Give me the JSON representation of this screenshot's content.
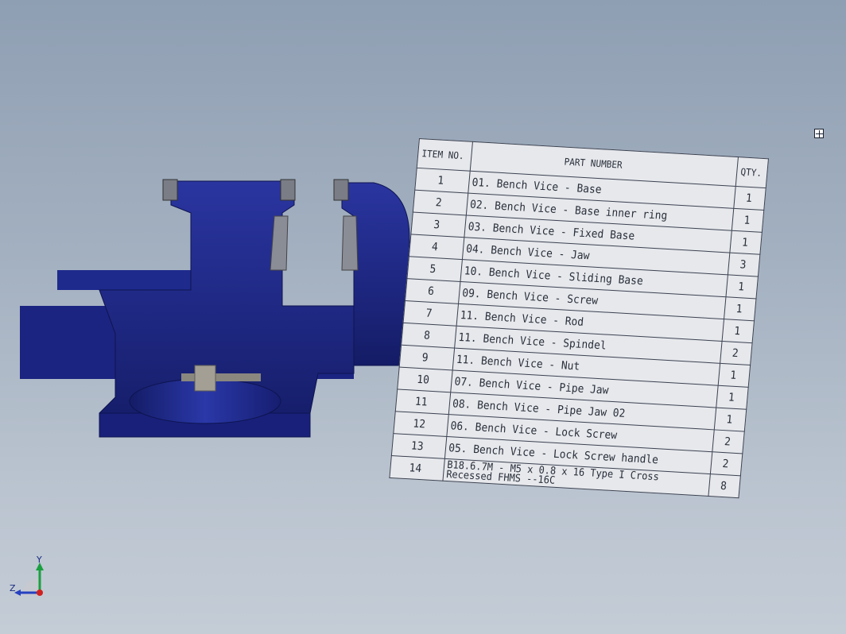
{
  "bom": {
    "header": {
      "item": "ITEM NO.",
      "part": "PART NUMBER",
      "qty": "QTY."
    },
    "rows": [
      {
        "item": "1",
        "part": "01. Bench Vice - Base",
        "qty": "1"
      },
      {
        "item": "2",
        "part": "02. Bench Vice - Base inner ring",
        "qty": "1"
      },
      {
        "item": "3",
        "part": "03. Bench Vice - Fixed Base",
        "qty": "1"
      },
      {
        "item": "4",
        "part": "04. Bench Vice - Jaw",
        "qty": "3"
      },
      {
        "item": "5",
        "part": "10. Bench Vice - Sliding Base",
        "qty": "1"
      },
      {
        "item": "6",
        "part": "09. Bench Vice - Screw",
        "qty": "1"
      },
      {
        "item": "7",
        "part": "11. Bench Vice - Rod",
        "qty": "1"
      },
      {
        "item": "8",
        "part": "11. Bench Vice - Spindel",
        "qty": "2"
      },
      {
        "item": "9",
        "part": "11. Bench Vice - Nut",
        "qty": "1"
      },
      {
        "item": "10",
        "part": "07. Bench Vice - Pipe Jaw",
        "qty": "1"
      },
      {
        "item": "11",
        "part": "08. Bench Vice - Pipe Jaw 02",
        "qty": "1"
      },
      {
        "item": "12",
        "part": "06. Bench Vice - Lock Screw",
        "qty": "2"
      },
      {
        "item": "13",
        "part": "05. Bench Vice - Lock Screw handle",
        "qty": "2"
      },
      {
        "item": "14",
        "part": "B18.6.7M - M5 x 0.8 x 16 Type I Cross Recessed FHMS --16C",
        "qty": "8"
      }
    ]
  },
  "triad": {
    "x": "",
    "y": "Y",
    "z": "Z"
  },
  "colors": {
    "vise_blue": "#1f2a8a",
    "vise_dark": "#141c66",
    "jaw_gray": "#8a8c96",
    "handle_gray": "#7c7a72",
    "background_top": "#8f9fb3",
    "background_bottom": "#c4ccd6"
  }
}
